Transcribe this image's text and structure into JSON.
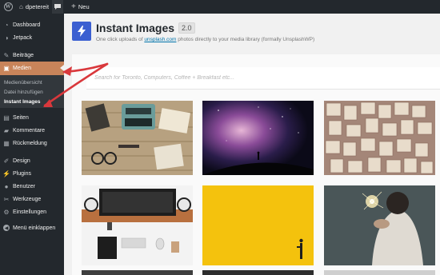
{
  "adminbar": {
    "site_name": "dpetereit",
    "new_label": "Neu"
  },
  "sidebar": {
    "items": [
      {
        "label": "Dashboard",
        "icon": "dashboard-icon"
      },
      {
        "label": "Jetpack",
        "icon": "jetpack-icon"
      },
      {
        "label": "Beiträge",
        "icon": "pin-icon"
      },
      {
        "label": "Medien",
        "icon": "media-icon"
      },
      {
        "label": "Seiten",
        "icon": "pages-icon"
      },
      {
        "label": "Kommentare",
        "icon": "comments-icon"
      },
      {
        "label": "Rückmeldung",
        "icon": "feedback-icon"
      },
      {
        "label": "Design",
        "icon": "appearance-icon"
      },
      {
        "label": "Plugins",
        "icon": "plugins-icon"
      },
      {
        "label": "Benutzer",
        "icon": "users-icon"
      },
      {
        "label": "Werkzeuge",
        "icon": "tools-icon"
      },
      {
        "label": "Einstellungen",
        "icon": "settings-icon"
      }
    ],
    "submenu": [
      "Medienübersicht",
      "Datei hinzufügen",
      "Instant Images"
    ],
    "collapse_label": "Menü einklappen"
  },
  "header": {
    "title": "Instant Images",
    "version": "2.0",
    "tagline_before": "One click uploads of ",
    "tagline_link": "unsplash.com",
    "tagline_after": " photos directly to your media library (formally UnsplashWP)"
  },
  "search": {
    "placeholder": "Search for Toronto, Computers, Coffee + Breakfast etc..."
  },
  "colors": {
    "adminbar": "#23282d",
    "menu_current": "#c8845a",
    "accent_blue": "#3b5fd1",
    "annotation_red": "#d9383c"
  }
}
